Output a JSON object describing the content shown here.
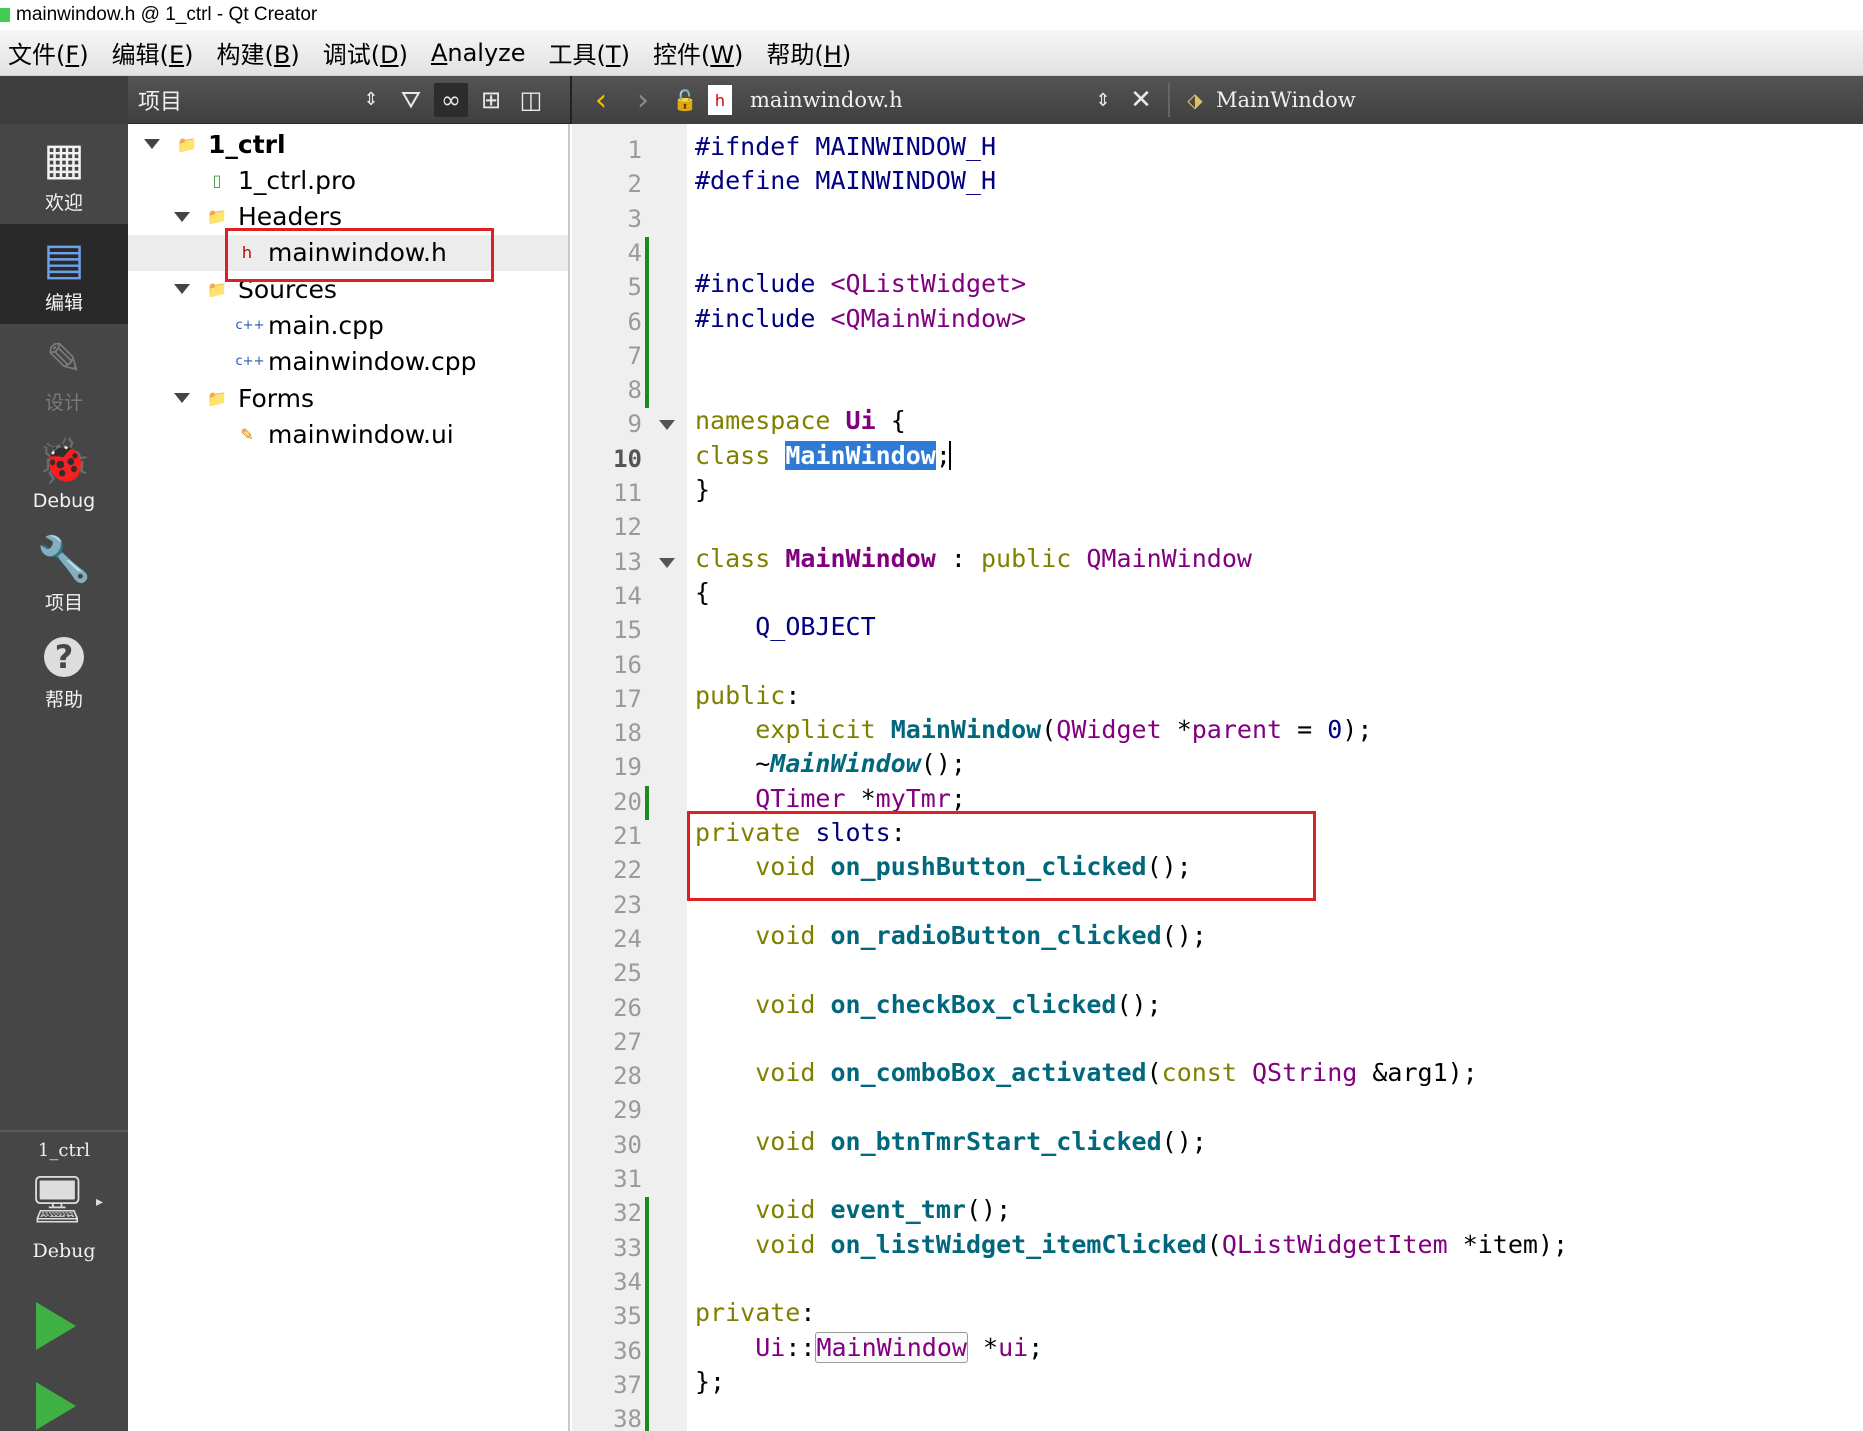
{
  "window": {
    "title": "mainwindow.h @ 1_ctrl - Qt Creator"
  },
  "menu": [
    {
      "label": "文件(",
      "key": "F",
      "end": ")"
    },
    {
      "label": "编辑(",
      "key": "E",
      "end": ")"
    },
    {
      "label": "构建(",
      "key": "B",
      "end": ")"
    },
    {
      "label": "调试(",
      "key": "D",
      "end": ")"
    },
    {
      "label": "",
      "key": "A",
      "end": "nalyze"
    },
    {
      "label": "工具(",
      "key": "T",
      "end": ")"
    },
    {
      "label": "控件(",
      "key": "W",
      "end": ")"
    },
    {
      "label": "帮助(",
      "key": "H",
      "end": ")"
    }
  ],
  "project_toolbar": {
    "combo_label": "项目"
  },
  "editor_toolbar": {
    "file_name": "mainwindow.h",
    "class_name": "MainWindow"
  },
  "modes": [
    {
      "label": "欢迎",
      "icon": "grid-icon",
      "glyph": "▦",
      "state": "normal"
    },
    {
      "label": "编辑",
      "icon": "edit-document-icon",
      "glyph": "▤",
      "state": "active"
    },
    {
      "label": "设计",
      "icon": "pencil-icon",
      "glyph": "✎",
      "state": "disabled"
    },
    {
      "label": "Debug",
      "icon": "bug-icon",
      "glyph": "🐞",
      "state": "normal"
    },
    {
      "label": "项目",
      "icon": "wrench-icon",
      "glyph": "🔧",
      "state": "normal"
    },
    {
      "label": "帮助",
      "icon": "help-icon",
      "glyph": "?",
      "state": "normal"
    }
  ],
  "kit": {
    "project": "1_ctrl",
    "config": "Debug"
  },
  "tree": [
    {
      "label": "1_ctrl",
      "depth": 0,
      "expanded": true,
      "icon": "qt-project-folder-icon",
      "bold": true
    },
    {
      "label": "1_ctrl.pro",
      "depth": 1,
      "icon": "pro-file-icon"
    },
    {
      "label": "Headers",
      "depth": 1,
      "expanded": true,
      "icon": "headers-folder-icon"
    },
    {
      "label": "mainwindow.h",
      "depth": 2,
      "icon": "header-file-icon",
      "selected": true
    },
    {
      "label": "Sources",
      "depth": 1,
      "expanded": true,
      "icon": "sources-folder-icon"
    },
    {
      "label": "main.cpp",
      "depth": 2,
      "icon": "cpp-file-icon"
    },
    {
      "label": "mainwindow.cpp",
      "depth": 2,
      "icon": "cpp-file-icon"
    },
    {
      "label": "Forms",
      "depth": 1,
      "expanded": true,
      "icon": "forms-folder-icon"
    },
    {
      "label": "mainwindow.ui",
      "depth": 2,
      "icon": "ui-file-icon"
    }
  ],
  "editor": {
    "current_line": 10,
    "line_count": 38,
    "lines": [
      "#ifndef MAINWINDOW_H",
      "#define MAINWINDOW_H",
      "",
      "",
      "#include <QListWidget>",
      "#include <QMainWindow>",
      "",
      "",
      "namespace Ui {",
      "class MainWindow;",
      "}",
      "",
      "class MainWindow : public QMainWindow",
      "{",
      "    Q_OBJECT",
      "",
      "public:",
      "    explicit MainWindow(QWidget *parent = 0);",
      "    ~MainWindow();",
      "    QTimer *myTmr;",
      "private slots:",
      "    void on_pushButton_clicked();",
      "",
      "    void on_radioButton_clicked();",
      "",
      "    void on_checkBox_clicked();",
      "",
      "    void on_comboBox_activated(const QString &arg1);",
      "",
      "    void on_btnTmrStart_clicked();",
      "",
      "    void event_tmr();",
      "    void on_listWidget_itemClicked(QListWidgetItem *item);",
      "",
      "private:",
      "    Ui::MainWindow *ui;",
      "};",
      ""
    ]
  }
}
